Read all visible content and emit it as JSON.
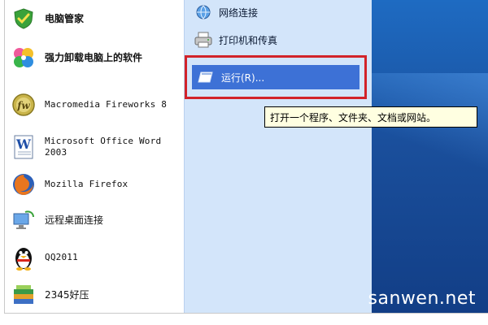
{
  "left_list": {
    "items": [
      {
        "label": "电脑管家",
        "icon": "shield-icon"
      },
      {
        "label": "强力卸载电脑上的软件",
        "icon": "clover-icon"
      },
      {
        "label": "Macromedia Fireworks 8",
        "icon": "fireworks-icon"
      },
      {
        "label_line1": "Microsoft Office Word",
        "label_line2": "2003",
        "icon": "word-icon"
      },
      {
        "label": "Mozilla Firefox",
        "icon": "firefox-icon"
      },
      {
        "label": "远程桌面连接",
        "icon": "remote-desktop-icon"
      },
      {
        "label": "QQ2011",
        "icon": "qq-penguin-icon"
      },
      {
        "label": "2345好压",
        "icon": "archive-books-icon"
      }
    ]
  },
  "right_pane": {
    "items": [
      {
        "label": "网络连接",
        "icon": "network-icon"
      },
      {
        "label": "打印机和传真",
        "icon": "printer-icon"
      }
    ],
    "run": {
      "label": "运行(R)...",
      "icon": "run-window-icon"
    }
  },
  "tooltip": {
    "text": "打开一个程序、文件夹、文档或网站。"
  },
  "watermark": {
    "text": "sanwen.net"
  },
  "colors": {
    "highlight": "#3d71d6",
    "right_pane_bg": "#d3e5fa",
    "annotation_box": "#d2232a",
    "tooltip_bg": "#ffffe1",
    "desktop": "#1a4f9c"
  }
}
